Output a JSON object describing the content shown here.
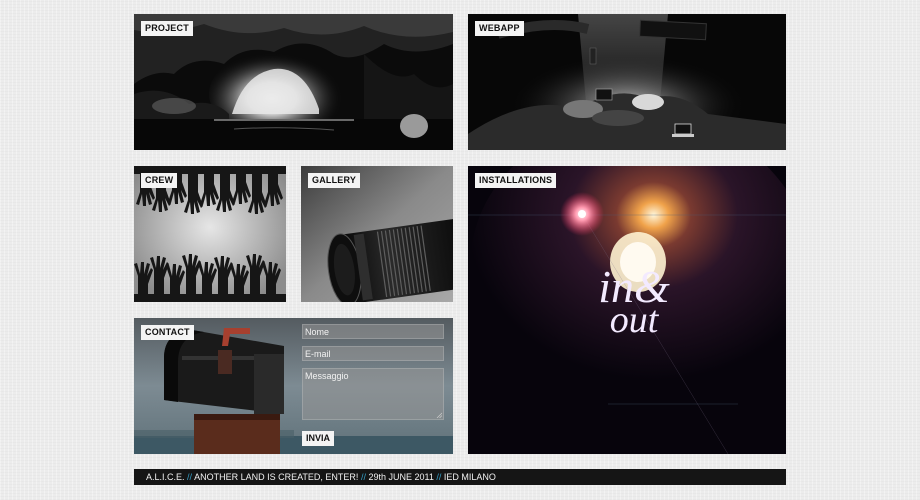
{
  "tiles": {
    "project": "PROJECT",
    "webapp": "WEBAPP",
    "crew": "CREW",
    "gallery": "GALLERY",
    "installations": "INSTALLATIONS",
    "contact": "CONTACT"
  },
  "installations_art": {
    "line1": "in&",
    "line2": "out"
  },
  "contact_form": {
    "name_placeholder": "Nome",
    "email_placeholder": "E-mail",
    "message_placeholder": "Messaggio",
    "submit_label": "INVIA"
  },
  "footer": {
    "separator": "//",
    "parts": [
      "A.L.I.C.E.",
      "ANOTHER LAND IS CREATED, ENTER!",
      "29th JUNE 2011",
      "IED MILANO"
    ]
  },
  "colors": {
    "separator": "#35a0c8",
    "footer_bg": "#151515",
    "page_bg": "#ececec"
  }
}
